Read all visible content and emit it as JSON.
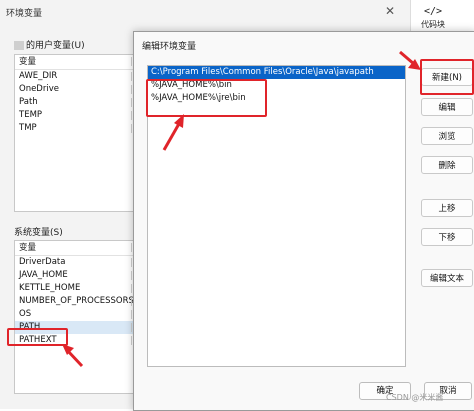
{
  "window": {
    "title": "环境变量",
    "close_glyph": "✕"
  },
  "side_tool": {
    "glyph": "</>",
    "label": "代码块"
  },
  "user_vars": {
    "label": "的用户变量(U)",
    "header": "变量",
    "items": [
      "AWE_DIR",
      "OneDrive",
      "Path",
      "TEMP",
      "TMP"
    ]
  },
  "system_vars": {
    "label": "系统变量(S)",
    "header": "变量",
    "items": [
      "DriverData",
      "JAVA_HOME",
      "KETTLE_HOME",
      "NUMBER_OF_PROCESSORS",
      "OS",
      "PATH",
      "PATHEXT"
    ]
  },
  "dialog": {
    "title": "编辑环境变量",
    "paths": [
      "C:\\Program Files\\Common Files\\Oracle\\Java\\javapath",
      "%JAVA_HOME%\\bin",
      "%JAVA_HOME%\\jre\\bin"
    ],
    "buttons": {
      "new": "新建(N)",
      "edit": "编辑",
      "browse": "浏览",
      "delete": "删除",
      "up": "上移",
      "down": "下移",
      "edit_text": "编辑文本"
    },
    "ok": "确定",
    "cancel": "取消"
  },
  "watermark": "CSDN @米米酱",
  "colors": {
    "selection": "#0a64c8",
    "annotation_red": "#e0242a"
  }
}
